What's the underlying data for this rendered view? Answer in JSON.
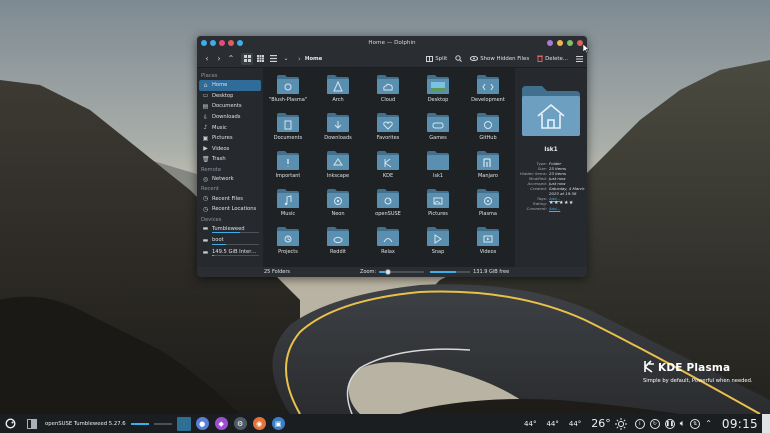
{
  "window": {
    "title": "Home — Dolphin",
    "tb_buttons": [
      "#3daee9",
      "#3daee9",
      "#e44c7f",
      "#e05f5f",
      "#3daee9"
    ],
    "tb_right_buttons": [
      "#a87cd4",
      "#f0b84a",
      "#7cc26a",
      "#e05f5f"
    ]
  },
  "toolbar": {
    "location": "Home",
    "split_label": "Split",
    "hidden_label": "Show Hidden Files",
    "delete_label": "Delete..."
  },
  "places": {
    "sections": [
      {
        "title": "Places",
        "items": [
          {
            "label": "Home",
            "icon": "home-icon",
            "active": true
          },
          {
            "label": "Desktop",
            "icon": "desktop-icon"
          },
          {
            "label": "Documents",
            "icon": "documents-icon"
          },
          {
            "label": "Downloads",
            "icon": "downloads-icon"
          },
          {
            "label": "Music",
            "icon": "music-icon"
          },
          {
            "label": "Pictures",
            "icon": "pictures-icon"
          },
          {
            "label": "Videos",
            "icon": "videos-icon"
          },
          {
            "label": "Trash",
            "icon": "trash-icon"
          }
        ]
      },
      {
        "title": "Remote",
        "items": [
          {
            "label": "Network",
            "icon": "network-icon"
          }
        ]
      },
      {
        "title": "Recent",
        "items": [
          {
            "label": "Recent Files",
            "icon": "recent-files-icon"
          },
          {
            "label": "Recent Locations",
            "icon": "recent-locations-icon"
          }
        ]
      },
      {
        "title": "Devices",
        "items": [
          {
            "label": "Tumbleweed",
            "icon": "drive-icon",
            "usage": 0.6
          },
          {
            "label": "boot",
            "icon": "drive-icon",
            "usage": 0.3
          },
          {
            "label": "149.5 GiB Internal ...",
            "icon": "drive-icon",
            "usage": 0.05
          }
        ]
      }
    ]
  },
  "files": [
    {
      "name": "\"Blush-Plasma\"",
      "icon": "gear-icon"
    },
    {
      "name": "Arch",
      "icon": "arch-icon"
    },
    {
      "name": "Cloud",
      "icon": "cloud-icon"
    },
    {
      "name": "Desktop",
      "icon": "desktop-icon"
    },
    {
      "name": "Development",
      "icon": "development-icon"
    },
    {
      "name": "Documents",
      "icon": "documents-icon"
    },
    {
      "name": "Downloads",
      "icon": "downloads-icon"
    },
    {
      "name": "Favorites",
      "icon": "heart-icon"
    },
    {
      "name": "Games",
      "icon": "gamepad-icon"
    },
    {
      "name": "GitHub",
      "icon": "github-icon"
    },
    {
      "name": "Important",
      "icon": "exclamation-icon"
    },
    {
      "name": "Inkscape",
      "icon": "inkscape-icon"
    },
    {
      "name": "KDE",
      "icon": "kde-icon"
    },
    {
      "name": "lsk1",
      "icon": "plain-folder-icon"
    },
    {
      "name": "Manjaro",
      "icon": "manjaro-icon"
    },
    {
      "name": "Music",
      "icon": "music-icon"
    },
    {
      "name": "Neon",
      "icon": "neon-icon"
    },
    {
      "name": "openSUSE",
      "icon": "opensuse-icon"
    },
    {
      "name": "Pictures",
      "icon": "pictures-icon"
    },
    {
      "name": "Plasma",
      "icon": "plasma-icon"
    },
    {
      "name": "Projects",
      "icon": "projects-icon"
    },
    {
      "name": "Reddit",
      "icon": "reddit-icon"
    },
    {
      "name": "Relax",
      "icon": "relax-icon"
    },
    {
      "name": "Snap",
      "icon": "snap-icon"
    },
    {
      "name": "Videos",
      "icon": "videos-icon"
    }
  ],
  "info": {
    "name": "lsk1",
    "props": [
      {
        "k": "Type:",
        "v": "Folder"
      },
      {
        "k": "Size:",
        "v": "25 items"
      },
      {
        "k": "Hidden items:",
        "v": "23 items"
      },
      {
        "k": "Modified:",
        "v": "Just now"
      },
      {
        "k": "Accessed:",
        "v": "Just now"
      },
      {
        "k": "Created:",
        "v": "Saturday, 4 March 2023 at 19:36"
      },
      {
        "k": "Tags:",
        "v": "Add...",
        "link": true
      },
      {
        "k": "Rating:",
        "v": "★★★★★",
        "stars": true
      },
      {
        "k": "Comment:",
        "v": "Add...",
        "link": true
      }
    ]
  },
  "status": {
    "count": "25 Folders",
    "zoom_label": "Zoom:",
    "zoom_level": 0.2,
    "free": "131.9 GiB free",
    "free_used": 0.65
  },
  "watermark": {
    "title": "KDE Plasma",
    "tagline": "Simple by default, Powerful when needed."
  },
  "panel": {
    "task_label": "openSUSE Tumbleweed 5.27.6",
    "temps": [
      "44°",
      "44°",
      "44°"
    ],
    "weather_temp": "26°",
    "clock": "09:15"
  },
  "colors": {
    "accent": "#3daee9",
    "folder": "#5a8fb0",
    "folder_dark": "#41708f"
  }
}
